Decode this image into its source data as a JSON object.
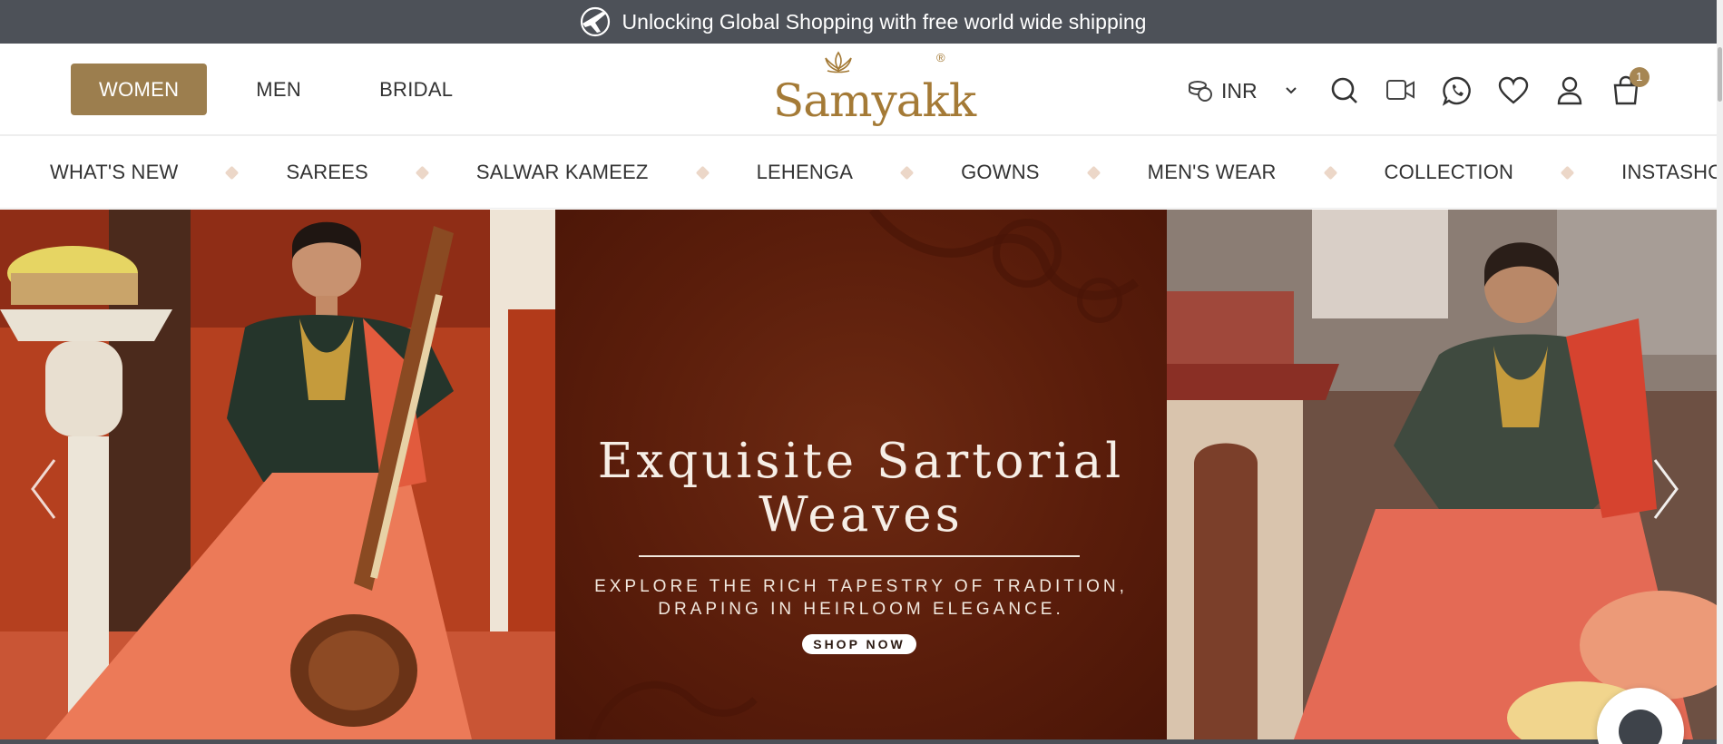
{
  "announcement": {
    "text": "Unlocking Global Shopping with free world wide shipping",
    "icon": "globe-plane-icon"
  },
  "header": {
    "gender_tabs": [
      {
        "label": "WOMEN",
        "active": true
      },
      {
        "label": "MEN",
        "active": false
      },
      {
        "label": "BRIDAL",
        "active": false
      }
    ],
    "logo_text": "Samyakk",
    "logo_reg": "®",
    "currency": "INR",
    "cart_count": "1",
    "icons": [
      "currency-icon",
      "search-icon",
      "video-call-icon",
      "whatsapp-icon",
      "wishlist-heart-icon",
      "account-icon",
      "cart-icon"
    ]
  },
  "category_nav": [
    "WHAT'S NEW",
    "SAREES",
    "SALWAR KAMEEZ",
    "LEHENGA",
    "GOWNS",
    "MEN'S WEAR",
    "COLLECTION",
    "INSTASHOP"
  ],
  "hero": {
    "title_line1": "Exquisite Sartorial",
    "title_line2": "Weaves",
    "subtitle_line1": "EXPLORE THE RICH TAPESTRY OF TRADITION,",
    "subtitle_line2": "DRAPING IN HEIRLOOM ELEGANCE.",
    "cta": "SHOP NOW"
  },
  "colors": {
    "announcement_bg": "#4d5158",
    "brand_gold": "#9c7e4e",
    "hero_maroon": "#5a1d0b"
  }
}
